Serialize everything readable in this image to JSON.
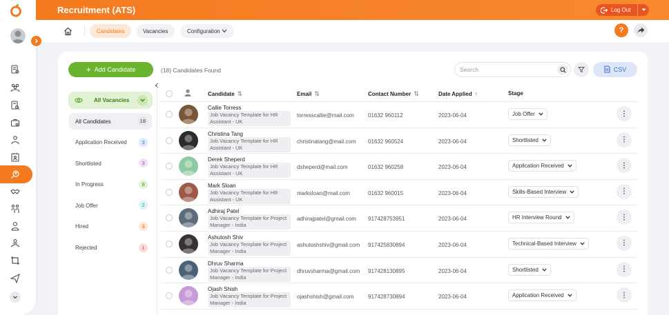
{
  "app": {
    "title": "Recruitment (ATS)",
    "logout_label": "Log Out"
  },
  "subnav": {
    "tabs": [
      {
        "label": "Candidates",
        "active": true
      },
      {
        "label": "Vacancies",
        "active": false
      },
      {
        "label": "Configuration",
        "active": false
      }
    ],
    "help_label": "?"
  },
  "toolbar": {
    "add_label": "Add Candidate",
    "found_text": "(18) Candidates Found",
    "search_placeholder": "Search",
    "csv_label": "CSV"
  },
  "vacancy_filter": {
    "label": "All Vacancies"
  },
  "stages": [
    {
      "label": "All Candidates",
      "count": "18",
      "active": true,
      "badge_bg": "#e3e5ea",
      "badge_fg": "#444"
    },
    {
      "label": "Application Received",
      "count": "3",
      "active": false,
      "badge_bg": "#dfe8fb",
      "badge_fg": "#3c6fd0"
    },
    {
      "label": "Shortlisted",
      "count": "3",
      "active": false,
      "badge_bg": "#efe0f6",
      "badge_fg": "#9b4fc3"
    },
    {
      "label": "In Progress",
      "count": "8",
      "active": false,
      "badge_bg": "#e2f2d6",
      "badge_fg": "#4f9a1f"
    },
    {
      "label": "Job Offer",
      "count": "2",
      "active": false,
      "badge_bg": "#dbf1f3",
      "badge_fg": "#2a97a3"
    },
    {
      "label": "Hired",
      "count": "3",
      "active": false,
      "badge_bg": "#fde3d6",
      "badge_fg": "#e0672a"
    },
    {
      "label": "Rejected",
      "count": "1",
      "active": false,
      "badge_bg": "#fbdddd",
      "badge_fg": "#d64545"
    }
  ],
  "table": {
    "columns": [
      "Candidate",
      "Email",
      "Contact Number",
      "Date Applied",
      "Stage"
    ],
    "rows": [
      {
        "name": "Callie Torress",
        "job": "Job Vacancy Template for HR Assistant - UK",
        "email": "torresscallie@mail.com",
        "phone": "01632 960112",
        "date": "2023-06-04",
        "stage": "Job Offer",
        "avatar_color": "#7a5638"
      },
      {
        "name": "Christina Tang",
        "job": "Job Vacancy Template for HR Assistant - UK",
        "email": "christinatang@mail.com",
        "phone": "01632 960524",
        "date": "2023-06-04",
        "stage": "Shortlisted",
        "avatar_color": "#2d2a2a"
      },
      {
        "name": "Derek Sheperd",
        "job": "Job Vacancy Template for HR Assistant - UK",
        "email": "dsheperd@mail.com",
        "phone": "01632 960258",
        "date": "2023-06-04",
        "stage": "Application Received",
        "avatar_color": "#8fc9a2"
      },
      {
        "name": "Mark Sloan",
        "job": "Job Vacancy Template for HR Assistant - UK",
        "email": "marksloan@mail.com",
        "phone": "01632 960015",
        "date": "2023-06-04",
        "stage": "Skills-Based Interview",
        "avatar_color": "#9c5a45"
      },
      {
        "name": "Adhiraj Patel",
        "job": "Job Vacancy Template for Project Manager - India",
        "email": "adhirajpatel@gmail.com",
        "phone": "917428753951",
        "date": "2023-06-04",
        "stage": "HR Interview Round",
        "avatar_color": "#5d6c7c"
      },
      {
        "name": "Ashutosh Shiv",
        "job": "Job Vacancy Template for Project Manager - India",
        "email": "ashutoshshiv@gmail.com",
        "phone": "917425830894",
        "date": "2023-06-04",
        "stage": "Technical-Based Interview",
        "avatar_color": "#3a3232"
      },
      {
        "name": "Dhruv Sharma",
        "job": "Job Vacancy Template for Project Manager - India",
        "email": "dhruvsharma@gmail.com",
        "phone": "917428130895",
        "date": "2023-06-04",
        "stage": "Shortlisted",
        "avatar_color": "#4d6176"
      },
      {
        "name": "Ojash Shish",
        "job": "Job Vacancy Template for Project Manager - India",
        "email": "ojashshish@gmail.com",
        "phone": "917428730894",
        "date": "2023-06-04",
        "stage": "Application Received",
        "avatar_color": "#c79ad9"
      }
    ]
  },
  "colors": {
    "brand": "#f47a1f",
    "accent_green": "#6ab32f",
    "csv_blue": "#3c6fd0"
  }
}
